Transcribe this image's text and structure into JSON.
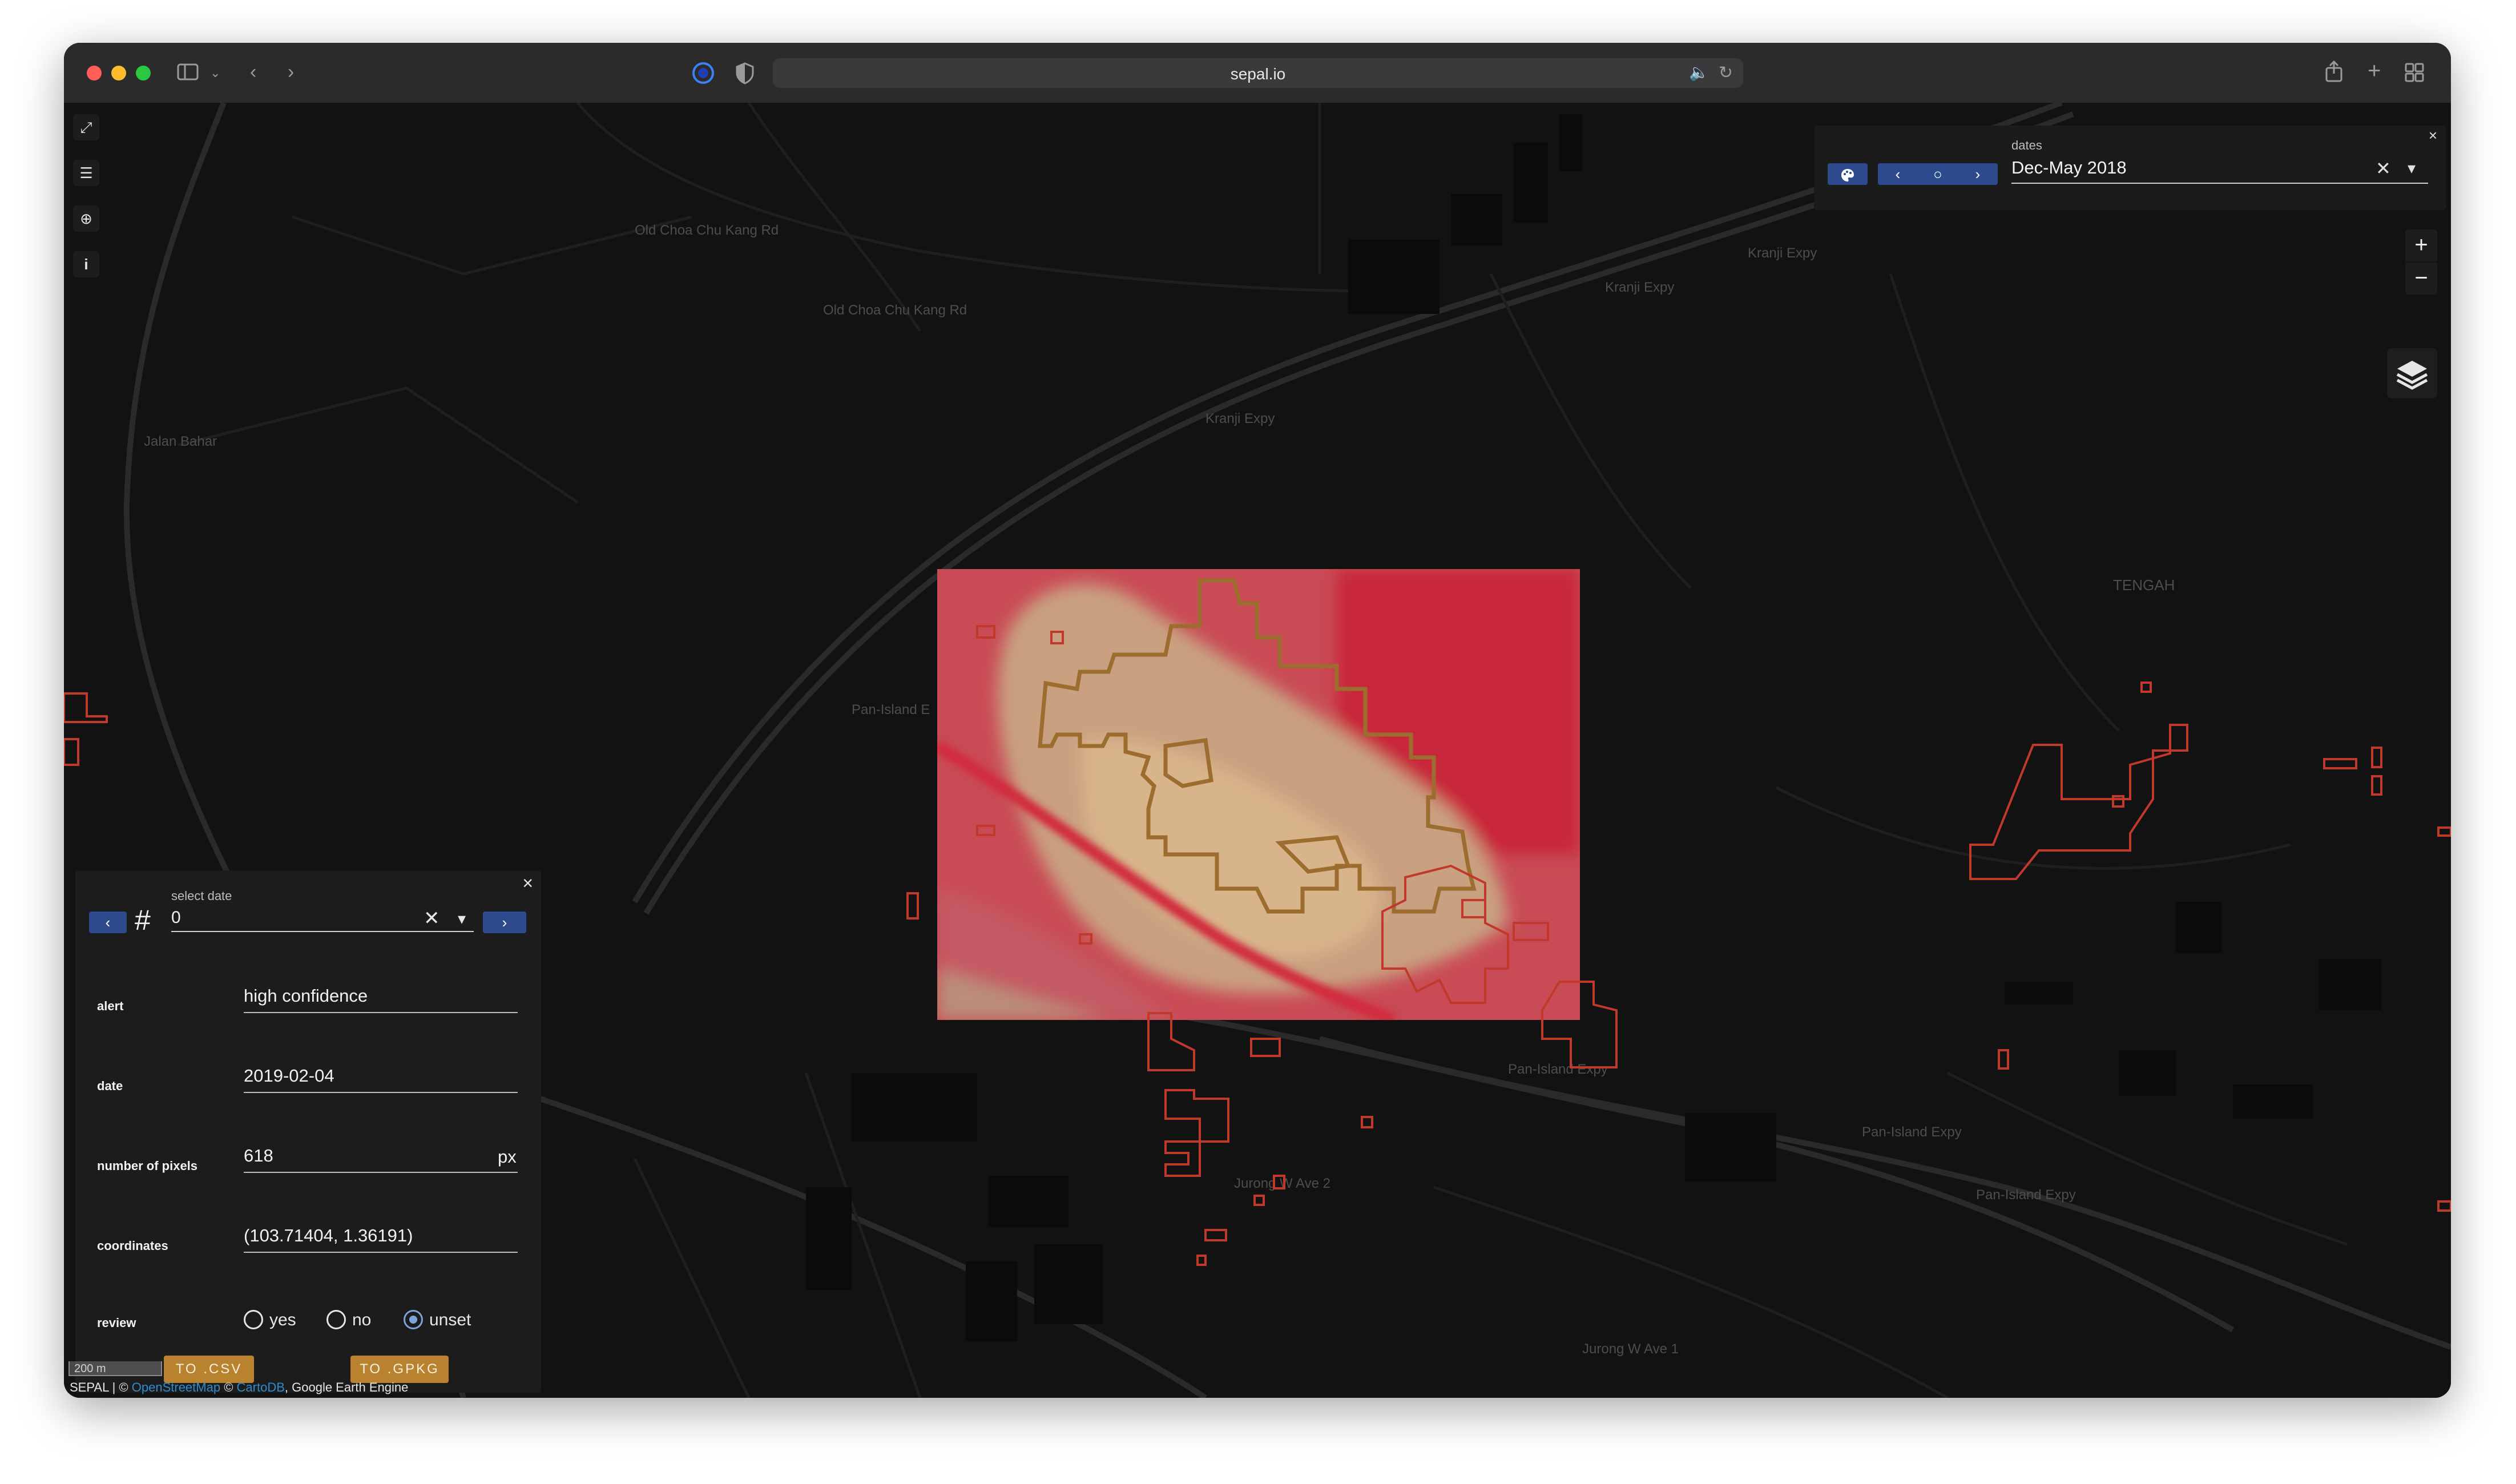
{
  "browser": {
    "url": "sepal.io"
  },
  "map": {
    "place_labels": [
      "Old Choa Chu Kang Rd",
      "Old Choa Chu Kang Rd",
      "Kranji Expy",
      "Kranji Expy",
      "Kranji Expy",
      "Pan-Island E",
      "Pan-Island Expy",
      "Pan-Island Expy",
      "Pan-Island Expy",
      "Jurong W Ave 2",
      "Jurong W Ave 1",
      "TENGAH",
      "Jalan Bahar"
    ],
    "scale_label": "200 m",
    "attribution": {
      "prefix": "SEPAL | ©",
      "osm": "OpenStreetMap",
      "sep": "©",
      "carto": "CartoDB",
      "suffix": ", Google Earth Engine"
    },
    "alert_color": "#c0392b",
    "selected_alert_color": "#b8822e"
  },
  "dates_panel": {
    "label": "dates",
    "value": "Dec-May 2018",
    "close": "×",
    "clear": "✕",
    "dropdown": "▾",
    "palette_icon": "palette-icon",
    "prev": "‹",
    "center": "○",
    "next": "›"
  },
  "zoom": {
    "in": "+",
    "out": "−"
  },
  "alert_panel": {
    "select_label": "select date",
    "select_value": "0",
    "hash": "#",
    "prev": "‹",
    "next": "›",
    "clear": "✕",
    "dropdown": "▾",
    "close": "×",
    "fields": {
      "alert": {
        "label": "alert",
        "value": "high confidence"
      },
      "date": {
        "label": "date",
        "value": "2019-02-04"
      },
      "pixels": {
        "label": "number of pixels",
        "value": "618",
        "unit": "px"
      },
      "coordinates": {
        "label": "coordinates",
        "value": "(103.71404, 1.36191)"
      }
    },
    "review": {
      "label": "review",
      "options": [
        "yes",
        "no",
        "unset"
      ],
      "selected": "unset"
    },
    "buttons": {
      "csv": "TO .CSV",
      "gpkg": "TO .GPKG"
    }
  }
}
